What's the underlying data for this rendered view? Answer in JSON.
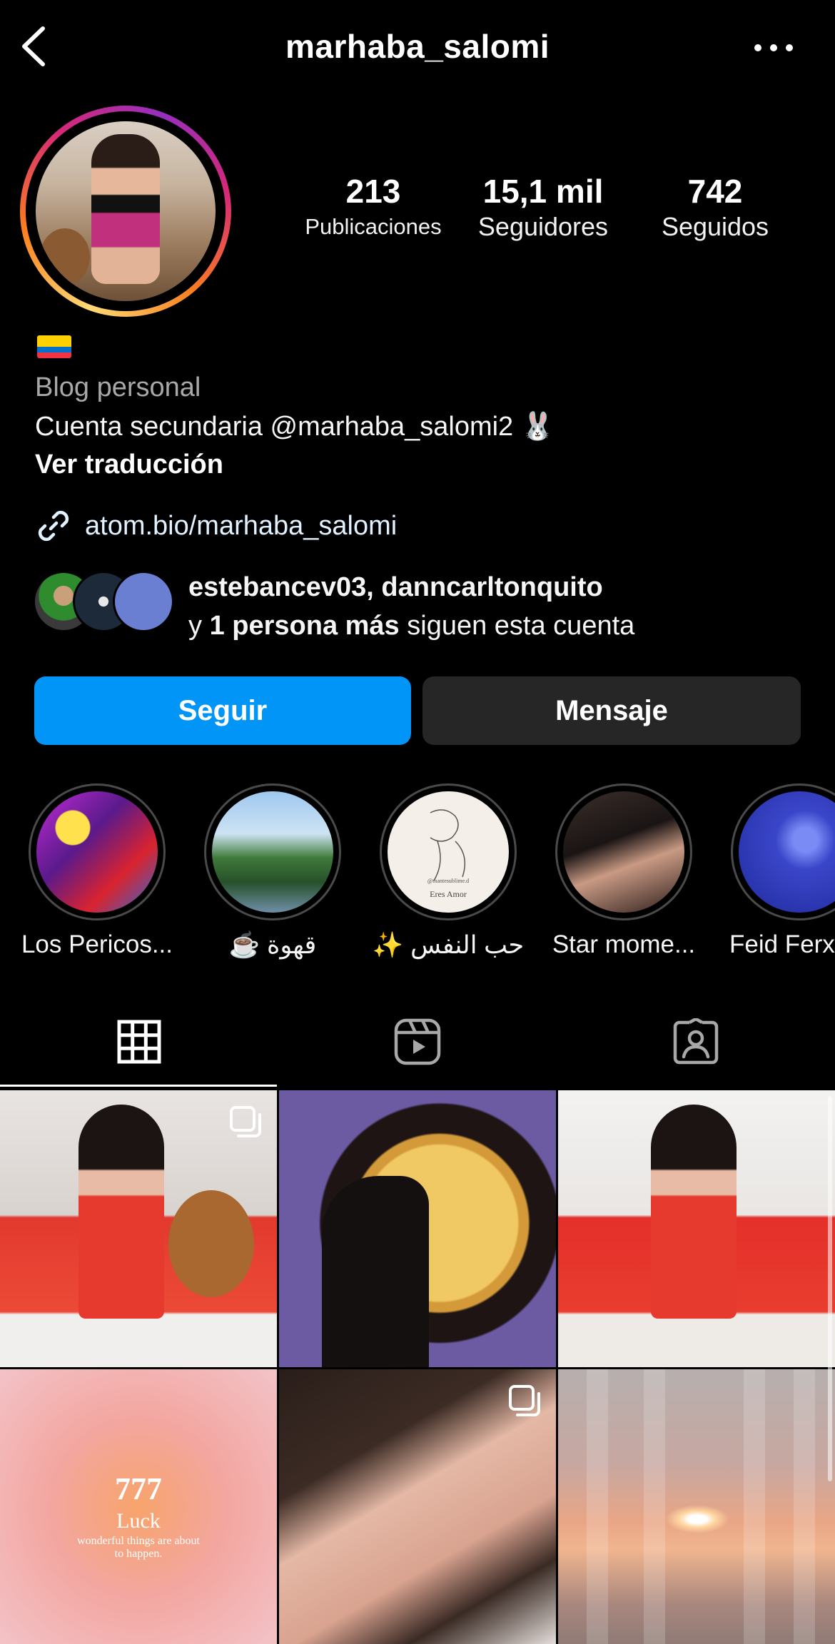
{
  "header": {
    "username": "marhaba_salomi",
    "back_icon": "chevron-left-icon",
    "more_icon": "more-horizontal-icon"
  },
  "profile": {
    "stats": {
      "posts_count": "213",
      "posts_label": "Publicaciones",
      "followers_count": "15,1 mil",
      "followers_label": "Seguidores",
      "following_count": "742",
      "following_label": "Seguidos"
    },
    "flag": "🇪🇨",
    "category": "Blog personal",
    "bio": "Cuenta secundaria @marhaba_salomi2 🐰",
    "translate_label": "Ver traducción",
    "link": "atom.bio/marhaba_salomi",
    "mutual": {
      "names": "estebancev03, danncarltonquito",
      "prefix": "y",
      "more": "1 persona más",
      "suffix": "siguen esta cuenta"
    }
  },
  "actions": {
    "follow_label": "Seguir",
    "message_label": "Mensaje"
  },
  "highlights": [
    {
      "label": "Los Pericos..."
    },
    {
      "label": "☕️ قهوة"
    },
    {
      "label": "✨ حب النفس"
    },
    {
      "label": "Star mome..."
    },
    {
      "label": "Feid Ferxx"
    }
  ],
  "highlight_text": {
    "credit": "@mantesublime.d",
    "caption": "Eres Amor"
  },
  "tabs": {
    "posts_icon": "grid-icon",
    "reels_icon": "reels-icon",
    "tagged_icon": "tagged-user-icon",
    "active": "posts"
  },
  "grid": {
    "luck_number": "777",
    "luck_word": "Luck",
    "luck_sub": "wonderful things are about to happen."
  },
  "colors": {
    "follow_button": "#0095f6",
    "message_button": "#262626",
    "background": "#000000",
    "category_text": "#a8a8a8"
  }
}
